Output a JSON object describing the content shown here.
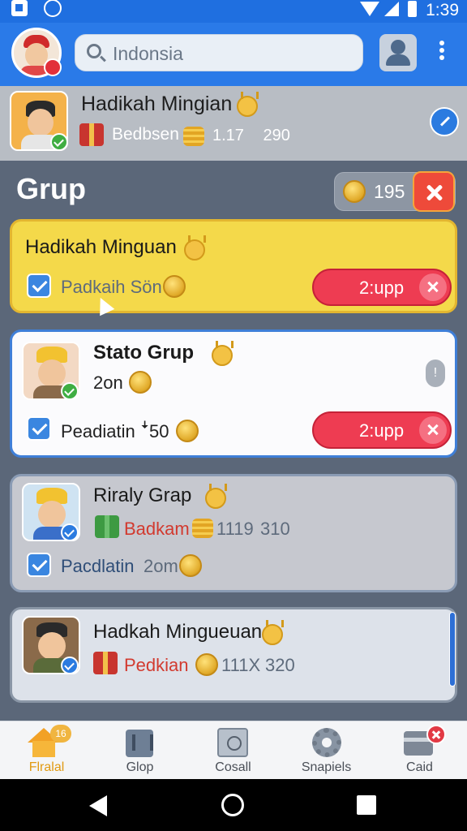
{
  "status_bar": {
    "time": "1:39"
  },
  "app_bar": {
    "search_placeholder": "Indonsia"
  },
  "pinned": {
    "title": "Hadikah Mingian",
    "sub_label": "Bedbsen",
    "num1": "1.17",
    "num2": "290"
  },
  "main": {
    "section_title": "Grup",
    "coin_count": "195"
  },
  "cards": [
    {
      "title": "Hadikah Minguan",
      "row_text": "Padkaih Sön",
      "button_label": "2:upp"
    },
    {
      "title": "Stato Grup",
      "sub_text": "2on",
      "row_text": "Peadiatin",
      "row_value": "ꜜ50",
      "button_label": "2:upp"
    },
    {
      "title": "Riraly Grap",
      "sub_label": "Badkam",
      "num1": "1119",
      "num2": "310",
      "row_text": "Pacdlatin",
      "row_value": "2om"
    },
    {
      "title": "Hadkah Mingueuan",
      "sub_label": "Pedkian",
      "num1": "111X",
      "num2": "320"
    }
  ],
  "bottom_nav": [
    {
      "label": "Flralal",
      "badge": "16",
      "icon": "home-icon"
    },
    {
      "label": "Glop",
      "icon": "box-icon"
    },
    {
      "label": "Cosall",
      "icon": "camera-icon"
    },
    {
      "label": "Snapiels",
      "icon": "gear-icon"
    },
    {
      "label": "Caid",
      "icon": "card-icon"
    }
  ],
  "colors": {
    "primary": "#2a7ae8",
    "accent_red": "#ee3c52",
    "card_yellow": "#f4d94a",
    "coin_gold": "#e0a928"
  }
}
